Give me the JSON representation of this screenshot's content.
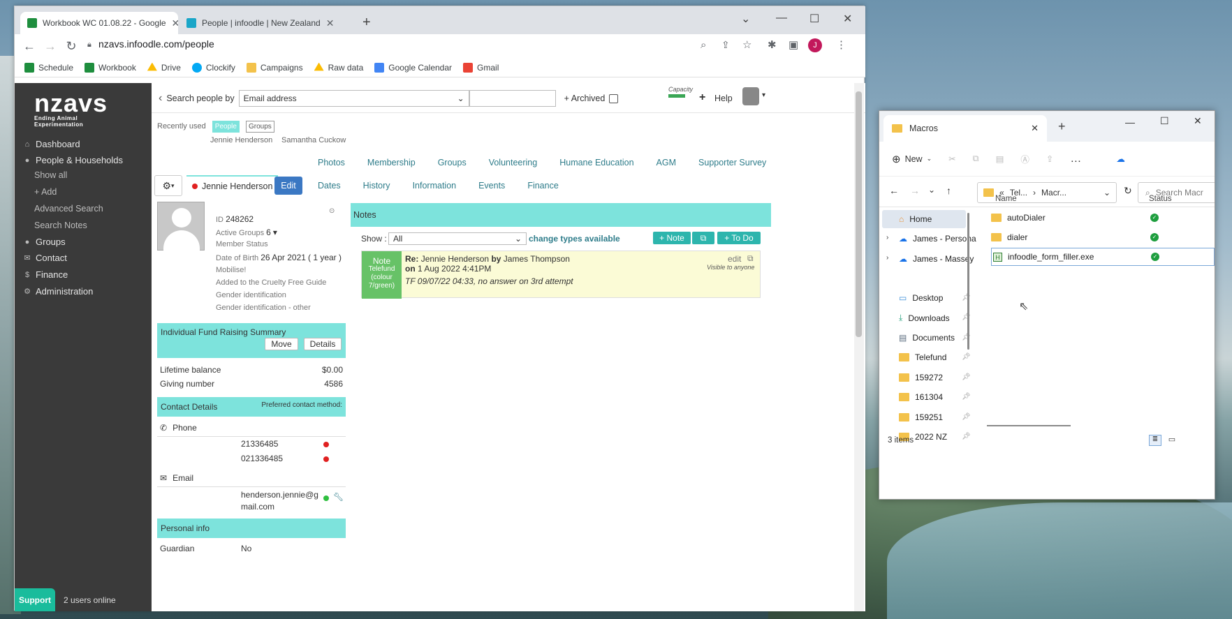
{
  "browser": {
    "tabs": [
      {
        "title": "Workbook WC 01.08.22 - Google",
        "active": true,
        "favicon_color": "#1e8e3e"
      },
      {
        "title": "People | infoodle | New Zealand",
        "active": false,
        "favicon_color": "#1aa6c8"
      }
    ],
    "url": "nzavs.infoodle.com/people",
    "profile_initial": "J",
    "bookmarks": [
      {
        "label": "Schedule",
        "icon_color": "#1e8e3e"
      },
      {
        "label": "Workbook",
        "icon_color": "#1e8e3e"
      },
      {
        "label": "Drive",
        "icon_color": "#fbbc04"
      },
      {
        "label": "Clockify",
        "icon_color": "#03a9f4"
      },
      {
        "label": "Campaigns",
        "icon_color": "#f3c24b"
      },
      {
        "label": "Raw data",
        "icon_color": "#fbbc04"
      },
      {
        "label": "Google Calendar",
        "icon_color": "#4285f4"
      },
      {
        "label": "Gmail",
        "icon_color": "#ea4335"
      }
    ]
  },
  "app": {
    "logo": "nzavs",
    "logo_tagline": "Ending Animal Experimentation",
    "sidebar": [
      {
        "label": "Dashboard",
        "icon": "home-icon",
        "sub": false
      },
      {
        "label": "People & Households",
        "icon": "person-icon",
        "sub": false
      },
      {
        "label": "Show all",
        "sub": true
      },
      {
        "label": "+ Add",
        "sub": true
      },
      {
        "label": "Advanced Search",
        "sub": true
      },
      {
        "label": "Search Notes",
        "sub": true
      },
      {
        "label": "Groups",
        "icon": "groups-icon",
        "sub": false
      },
      {
        "label": "Contact",
        "icon": "envelope-icon",
        "sub": false
      },
      {
        "label": "Finance",
        "icon": "dollar-icon",
        "sub": false
      },
      {
        "label": "Administration",
        "icon": "gears-icon",
        "sub": false
      }
    ],
    "support_label": "Support",
    "users_online": "2 users online",
    "search": {
      "label": "Search people by",
      "selected": "Email address",
      "archived_label": "+ Archived",
      "capacity_label": "Capacity",
      "help_label": "Help"
    },
    "recent": {
      "label": "Recently used",
      "pills": [
        "People",
        "Groups"
      ],
      "names": [
        "Jennie Henderson",
        "Samantha Cuckow"
      ]
    },
    "tabs_row1": [
      "Photos",
      "Membership",
      "Groups",
      "Volunteering",
      "Humane Education",
      "AGM",
      "Supporter Survey"
    ],
    "tabs_row2": [
      "Dates",
      "History",
      "Information",
      "Events",
      "Finance"
    ],
    "person": {
      "name": "Jennie Henderson",
      "edit_label": "Edit",
      "id_label": "ID",
      "id": "248262",
      "active_groups_label": "Active Groups",
      "active_groups": "6",
      "member_status": "Member Status",
      "dob_label": "Date of Birth",
      "dob": "26 Apr 2021",
      "age": "( 1 year )",
      "lines": [
        "Mobilise!",
        "Added to the Cruelty Free Guide",
        "Gender identification",
        "Gender identification - other"
      ]
    },
    "fundraising": {
      "title": "Individual Fund Raising Summary",
      "move_label": "Move",
      "details_label": "Details",
      "lifetime_label": "Lifetime balance",
      "lifetime_value": "$0.00",
      "giving_label": "Giving number",
      "giving_value": "4586"
    },
    "contact": {
      "title": "Contact Details",
      "preferred": "Preferred contact method:",
      "phone_label": "Phone",
      "phones": [
        "21336485",
        "021336485"
      ],
      "email_label": "Email",
      "email_line1": "henderson.jennie@g",
      "email_line2": "mail.com"
    },
    "personal": {
      "title": "Personal info",
      "guardian_label": "Guardian",
      "guardian_value": "No"
    },
    "notes": {
      "title": "Notes",
      "show_label": "Show :",
      "show_selected": "All",
      "change_types": "change types available",
      "note_btn": "+ Note",
      "todo_btn": "+ To Do",
      "card": {
        "tag_line1": "Note",
        "tag_line2": "Telefund",
        "tag_line3": "(colour",
        "tag_line4": "7/green)",
        "re_prefix": "Re:",
        "re_name": "Jennie Henderson",
        "by_word": "by",
        "author": "James Thompson",
        "on_word": "on",
        "date": "1 Aug 2022 4:41PM",
        "body": "TF 09/07/22 04:33, no answer on 3rd attempt",
        "edit_label": "edit",
        "visibility": "Visible to anyone"
      }
    }
  },
  "explorer": {
    "tab_title": "Macros",
    "new_label": "New",
    "path_parts": [
      "Tel...",
      "Macr..."
    ],
    "search_placeholder": "Search Macr",
    "nav": [
      {
        "label": "Home",
        "type": "home"
      },
      {
        "label": "James - Persona",
        "type": "cloud"
      },
      {
        "label": "James - Massey",
        "type": "cloud"
      },
      {
        "label": "Desktop",
        "type": "desktop",
        "pinned": true
      },
      {
        "label": "Downloads",
        "type": "download",
        "pinned": true
      },
      {
        "label": "Documents",
        "type": "document",
        "pinned": true
      },
      {
        "label": "Telefund",
        "type": "folder",
        "pinned": true
      },
      {
        "label": "159272",
        "type": "folder",
        "pinned": true
      },
      {
        "label": "161304",
        "type": "folder",
        "pinned": true
      },
      {
        "label": "159251",
        "type": "folder",
        "pinned": true
      },
      {
        "label": "2022 NZ",
        "type": "folder",
        "pinned": true
      }
    ],
    "columns": {
      "name": "Name",
      "status": "Status"
    },
    "files": [
      {
        "name": "autoDialer",
        "type": "folder"
      },
      {
        "name": "dialer",
        "type": "folder"
      },
      {
        "name": "infoodle_form_filler.exe",
        "type": "exe"
      }
    ],
    "status_text": "3 items"
  }
}
